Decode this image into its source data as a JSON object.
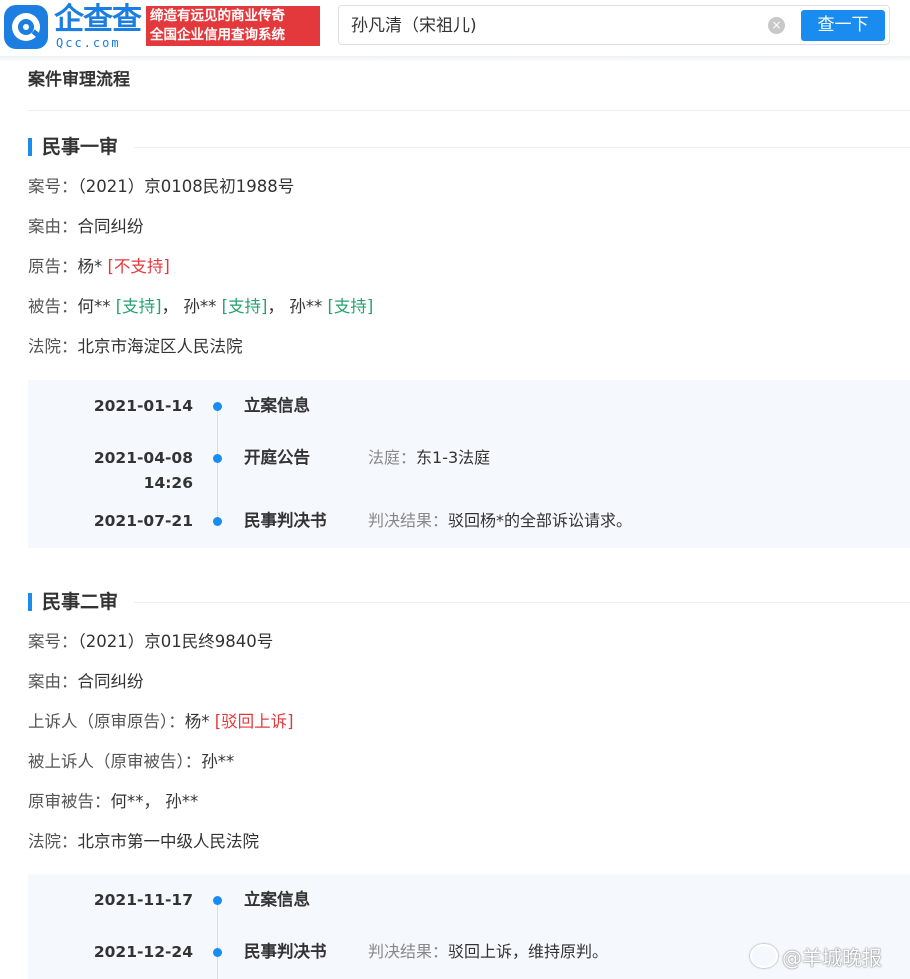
{
  "header": {
    "logo_cn": "企查查",
    "logo_en": "Qcc.com",
    "slogan_line1": "缔造有远见的商业传奇",
    "slogan_line2": "全国企业信用查询系统",
    "search_value": "孙凡清（宋祖儿)",
    "search_button": "查一下",
    "clear_icon": "×"
  },
  "panel_title": "案件审理流程",
  "colors": {
    "accent": "#1a8cf0",
    "red_tag": "#e4393c",
    "green_tag": "#26a26e",
    "timeline_bg": "#f5f8fd"
  },
  "first_trial": {
    "heading": "民事一审",
    "case_no_label": "案号：",
    "case_no": "（2021）京0108民初1988号",
    "cause_label": "案由：",
    "cause": "合同纠纷",
    "plaintiff_label": "原告：",
    "plaintiff": "杨*",
    "plaintiff_tag": "[不支持]",
    "defendant_label": "被告：",
    "defendants": [
      {
        "name": "何**",
        "tag": "[支持]"
      },
      {
        "name": "孙**",
        "tag": "[支持]"
      },
      {
        "name": "孙**",
        "tag": "[支持]"
      }
    ],
    "separator": "，",
    "court_label": "法院：",
    "court": "北京市海淀区人民法院",
    "timeline": [
      {
        "date": "2021-01-14",
        "time": "",
        "title": "立案信息",
        "detail_label": "",
        "detail": ""
      },
      {
        "date": "2021-04-08",
        "time": "14:26",
        "title": "开庭公告",
        "detail_label": "法庭：",
        "detail": "东1-3法庭"
      },
      {
        "date": "2021-07-21",
        "time": "",
        "title": "民事判决书",
        "detail_label": "判决结果：",
        "detail": "驳回杨*的全部诉讼请求。"
      }
    ]
  },
  "second_trial": {
    "heading": "民事二审",
    "case_no_label": "案号：",
    "case_no": "（2021）京01民终9840号",
    "cause_label": "案由：",
    "cause": "合同纠纷",
    "appellant_label": "上诉人（原审原告）：",
    "appellant": "杨*",
    "appellant_tag": "[驳回上诉]",
    "appellee_label": "被上诉人（原审被告）：",
    "appellee": "孙**",
    "orig_def_label": "原审被告：",
    "orig_def": "何**， 孙**",
    "court_label": "法院：",
    "court": "北京市第一中级人民法院",
    "timeline": [
      {
        "date": "2021-11-17",
        "title": "立案信息",
        "detail_label": "",
        "detail": ""
      },
      {
        "date": "2021-12-24",
        "title": "民事判决书",
        "detail_label": "判决结果：",
        "detail": "驳回上诉，维持原判。"
      }
    ]
  },
  "watermark": "@羊城晚报"
}
